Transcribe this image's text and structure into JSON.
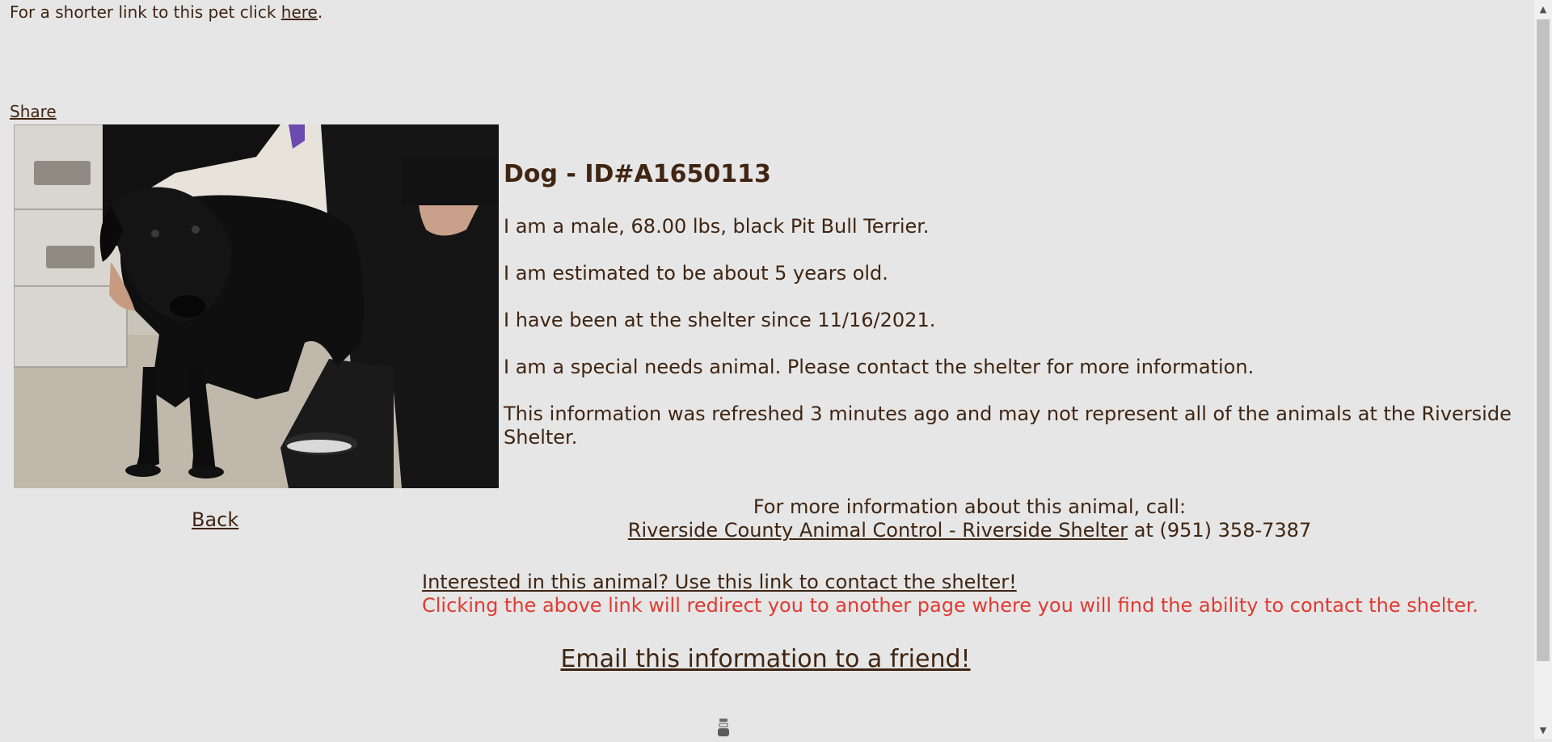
{
  "header": {
    "short_link_prefix": "For a shorter link to this pet click ",
    "short_link_label": "here",
    "short_link_suffix": "."
  },
  "share_label": "Share",
  "photo": {
    "description_icon": "dog-photo"
  },
  "back_label": "Back",
  "animal": {
    "title": "Dog - ID#A1650113",
    "line1": "I am a male, 68.00 lbs, black Pit Bull Terrier.",
    "line2": "I am estimated to be about 5 years old.",
    "line3": "I have been at the shelter since 11/16/2021.",
    "line4": "I am a special needs animal. Please contact the shelter for more information.",
    "line5": "This information was refreshed 3 minutes ago and may not represent all of the animals at the Riverside Shelter."
  },
  "contact": {
    "heading": "For more information about this animal, call:",
    "shelter_link": "Riverside County Animal Control - Riverside Shelter",
    "phone_text": " at (951) 358-7387"
  },
  "interest": {
    "link": "Interested in this animal? Use this link to contact the shelter!",
    "note": "Clicking the above link will redirect you to another page where you will find the ability to contact the shelter."
  },
  "email_label": "Email this information to a friend!",
  "colors": {
    "background": "#e6e6e6",
    "text": "#3f2512",
    "warning": "#e03a32"
  }
}
